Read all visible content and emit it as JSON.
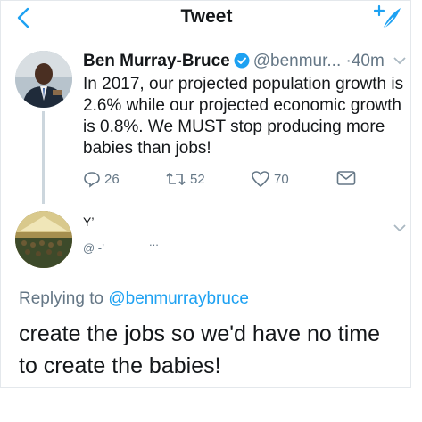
{
  "header": {
    "title": "Tweet",
    "back_icon": "chevron-left-icon",
    "compose_icon": "compose-feather-icon",
    "accent": "#1da1f2"
  },
  "tweet": {
    "author_name": "Ben Murray-Bruce",
    "handle": "@benmur...",
    "time_prefix": "·",
    "time": "40m",
    "text": "In 2017, our projected population growth is 2.6% while our projected economic growth is 0.8%. We MUST stop producing more babies than jobs!",
    "actions": {
      "replies": "26",
      "retweets": "52",
      "likes": "70"
    }
  },
  "reply": {
    "author_name": "Y’",
    "handle": "@ -’",
    "dots": "...",
    "replying_prefix": "Replying to",
    "replying_handle": "@benmurraybruce",
    "text": "create the jobs so we'd have no time to create the babies!"
  }
}
